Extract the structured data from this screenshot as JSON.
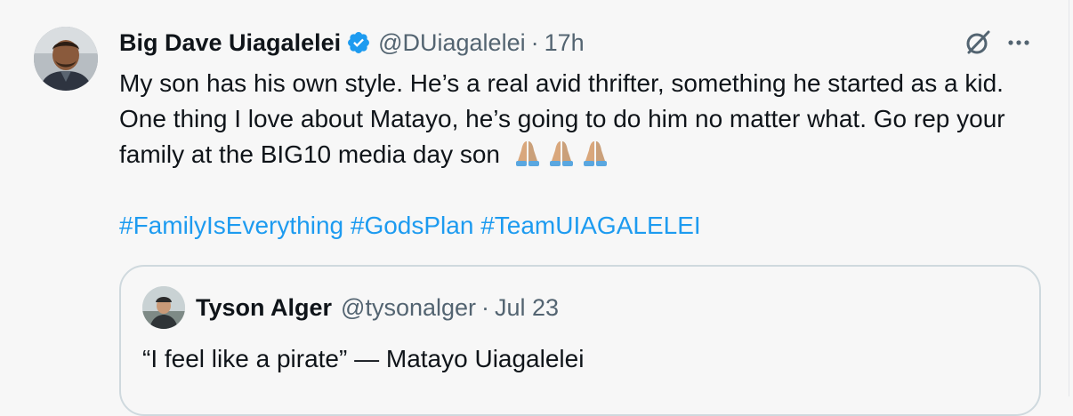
{
  "tweet": {
    "author_name": "Big Dave Uiagalelei",
    "handle": "@DUiagalelei",
    "separator": "·",
    "time": "17h",
    "text_line": "My son has his own style. He’s a real avid thrifter, something he started as a kid. One thing I love about Matayo, he’s going to do him no matter what. Go rep your family at the BIG10 media day son",
    "emojis": [
      "folded-hands-emoji",
      "folded-hands-emoji",
      "folded-hands-emoji"
    ],
    "hashtags": [
      "#FamilyIsEverything",
      "#GodsPlan",
      "#TeamUIAGALELEI"
    ],
    "accent_color": "#1d9bf0",
    "verified_color": "#1d9bf0"
  },
  "quote": {
    "author_name": "Tyson Alger",
    "handle": "@tysonalger",
    "separator": "·",
    "date": "Jul 23",
    "text": "“I feel like a pirate” — Matayo Uiagalelei"
  },
  "icons": {
    "grok": "grok-icon",
    "more": "more-icon",
    "verified": "verified-badge-icon"
  }
}
